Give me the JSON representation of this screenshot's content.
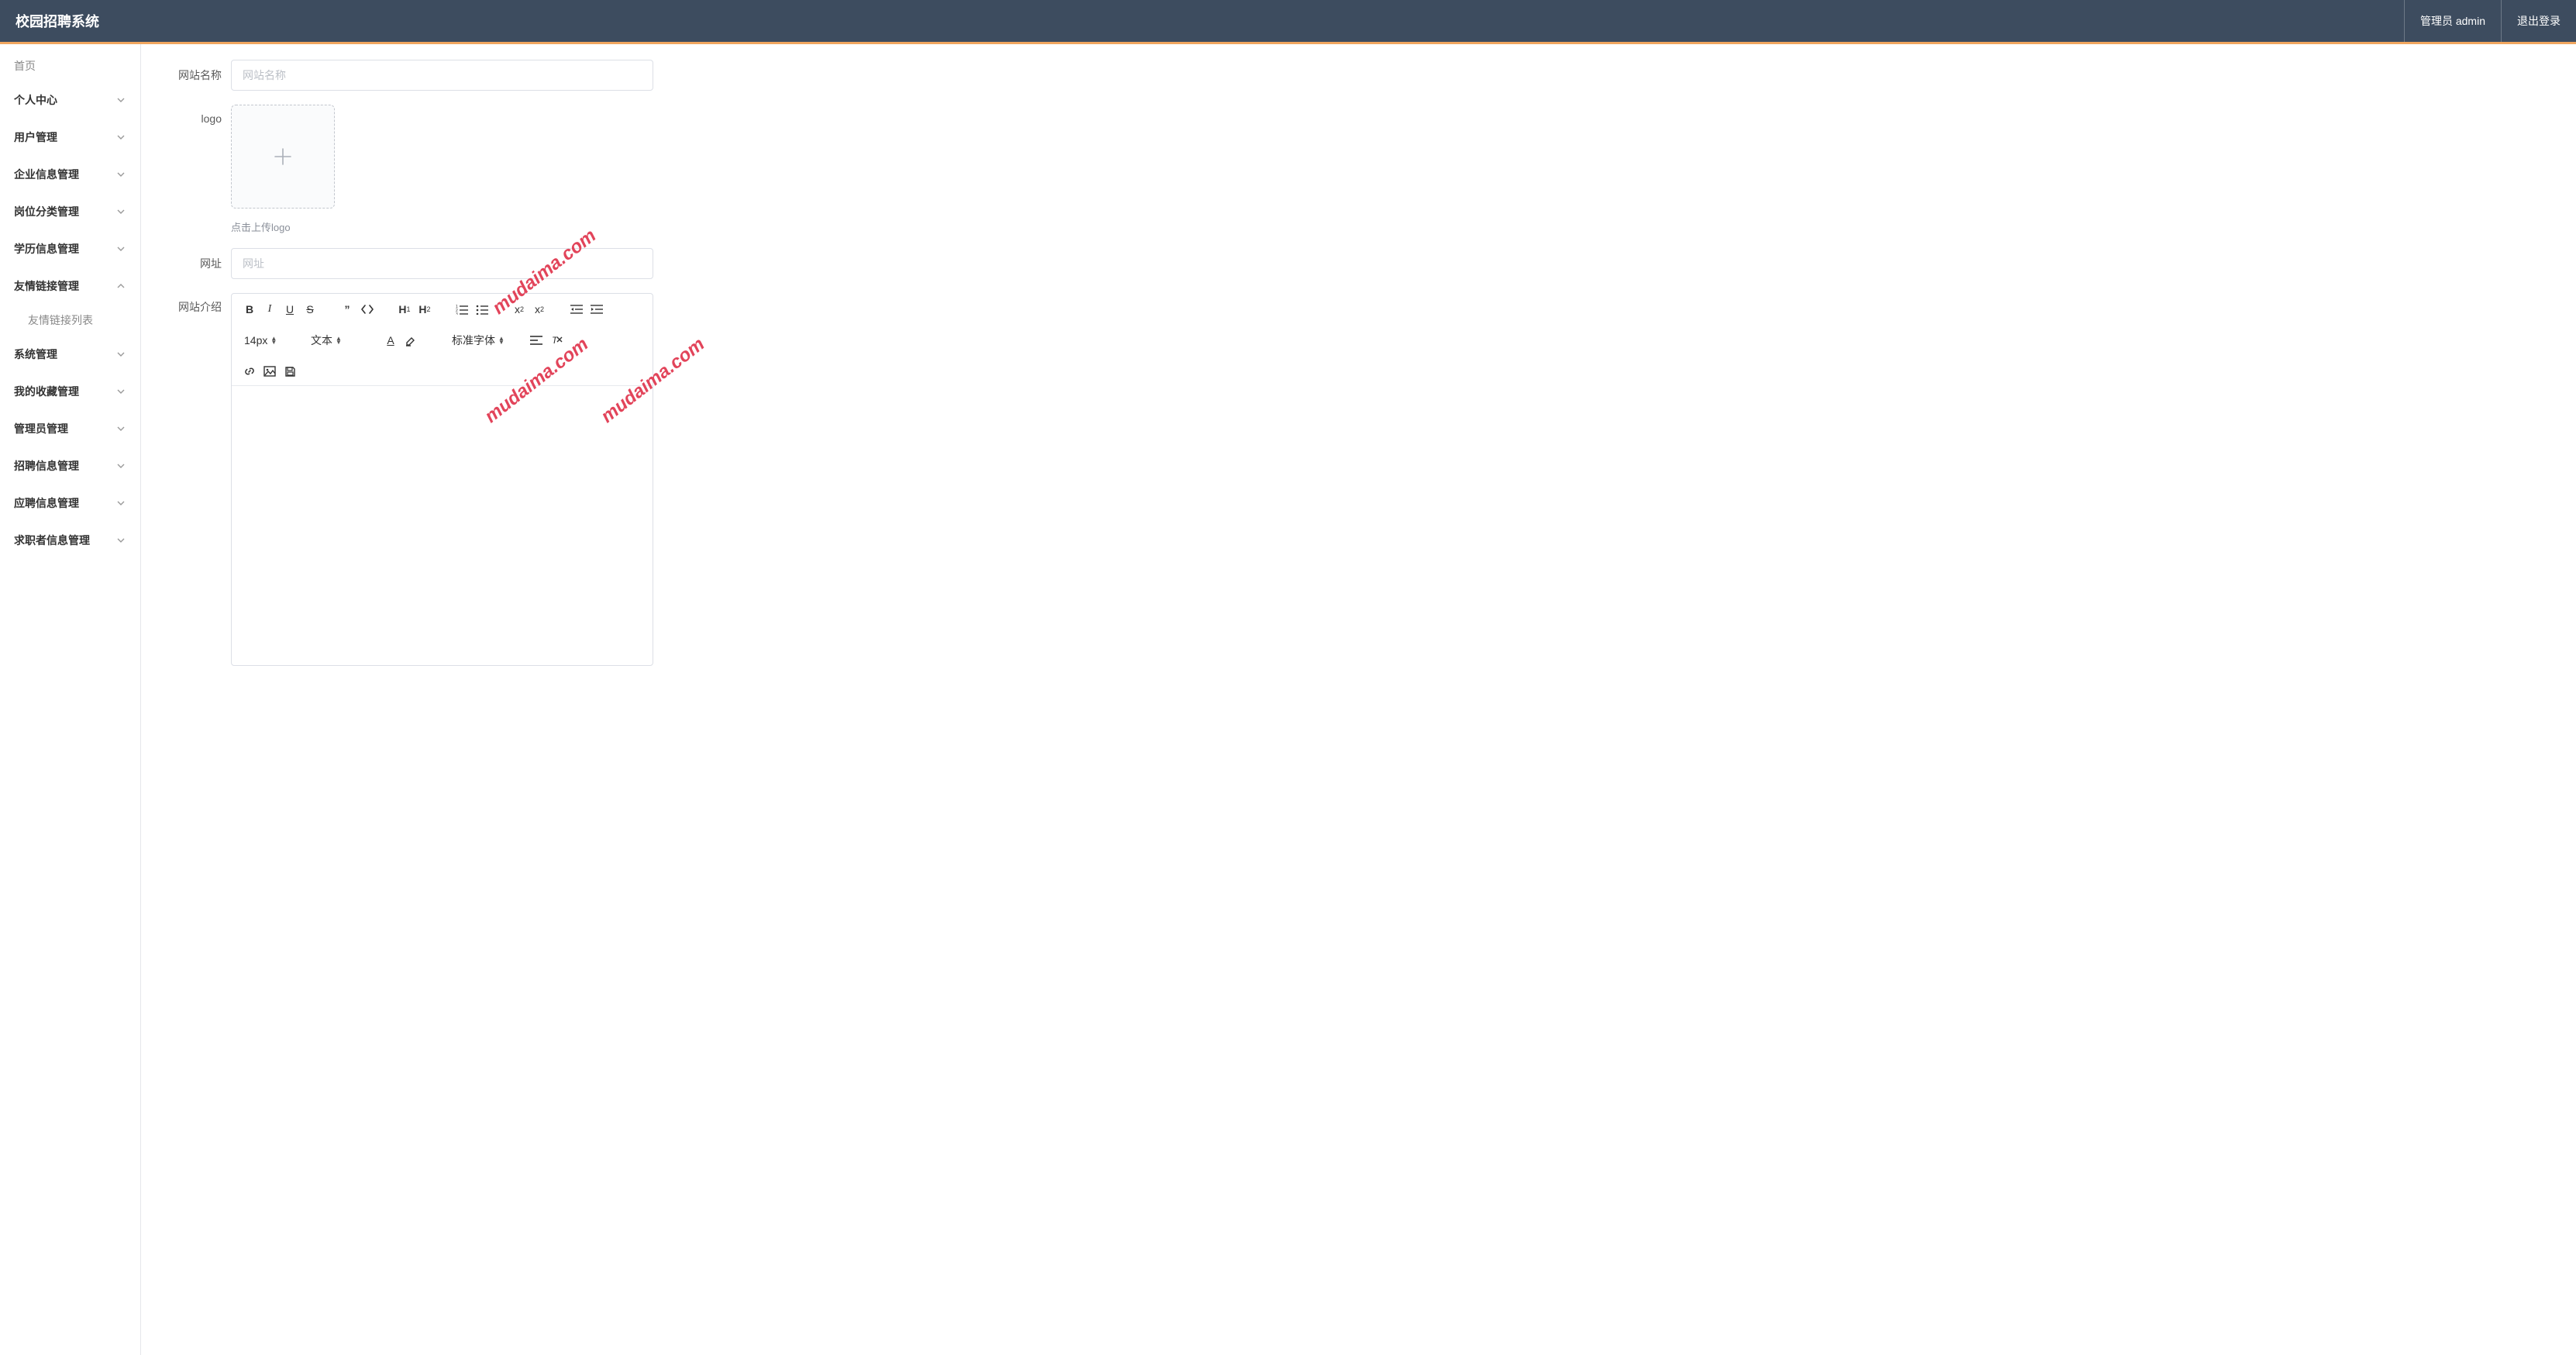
{
  "header": {
    "brand": "校园招聘系统",
    "admin_label": "管理员 admin",
    "logout_label": "退出登录"
  },
  "sidebar": {
    "home_label": "首页",
    "items": [
      {
        "label": "个人中心",
        "expanded": false
      },
      {
        "label": "用户管理",
        "expanded": false
      },
      {
        "label": "企业信息管理",
        "expanded": false
      },
      {
        "label": "岗位分类管理",
        "expanded": false
      },
      {
        "label": "学历信息管理",
        "expanded": false
      },
      {
        "label": "友情链接管理",
        "expanded": true,
        "children": [
          {
            "label": "友情链接列表"
          }
        ]
      },
      {
        "label": "系统管理",
        "expanded": false
      },
      {
        "label": "我的收藏管理",
        "expanded": false
      },
      {
        "label": "管理员管理",
        "expanded": false
      },
      {
        "label": "招聘信息管理",
        "expanded": false
      },
      {
        "label": "应聘信息管理",
        "expanded": false
      },
      {
        "label": "求职者信息管理",
        "expanded": false
      }
    ]
  },
  "form": {
    "site_name_label": "网站名称",
    "site_name_placeholder": "网站名称",
    "logo_label": "logo",
    "logo_tip": "点击上传logo",
    "url_label": "网址",
    "url_placeholder": "网址",
    "intro_label": "网站介绍"
  },
  "editor_toolbar": {
    "font_size_selected": "14px",
    "block_style_selected": "文本",
    "font_family_selected": "标准字体"
  },
  "watermark": "mudaima.com"
}
